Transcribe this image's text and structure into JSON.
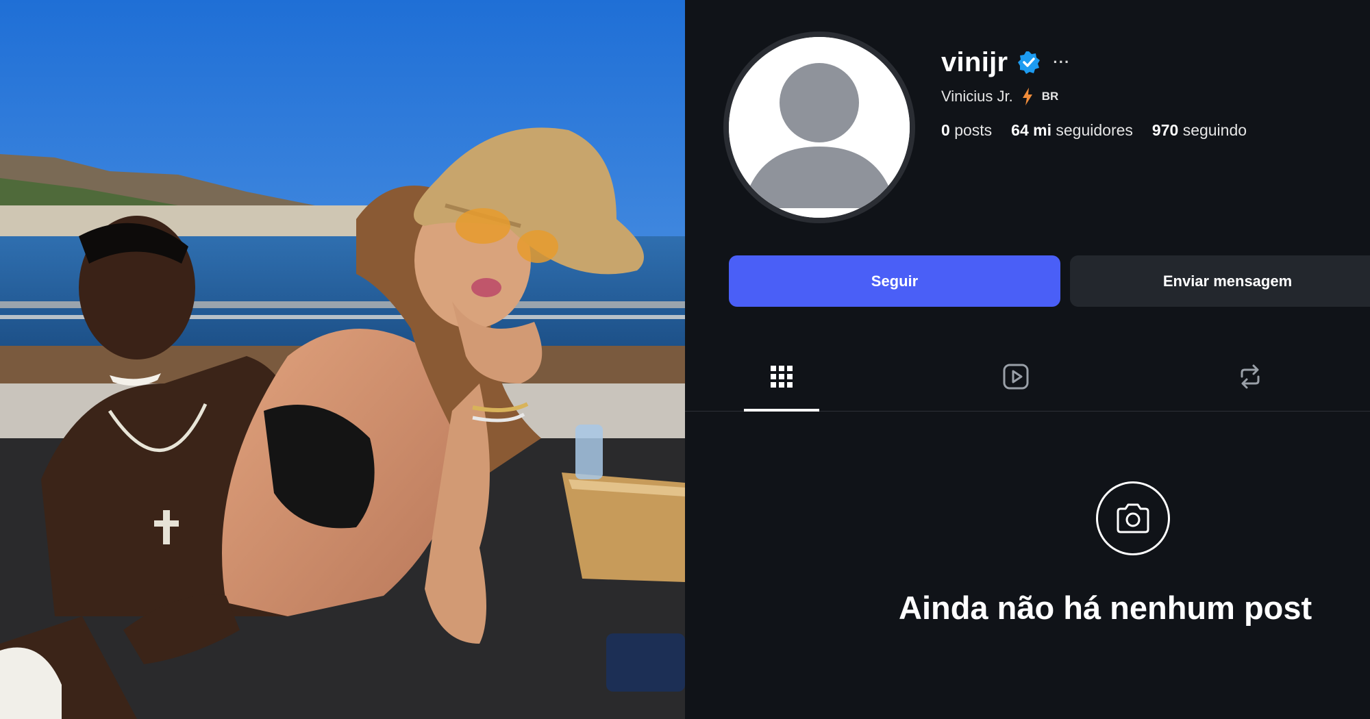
{
  "profile": {
    "username": "vinijr",
    "more_label": "···",
    "full_name": "Vinicius Jr.",
    "country_code": "BR",
    "stats": {
      "posts_value": "0",
      "posts_label": "posts",
      "followers_value": "64 mi",
      "followers_label": "seguidores",
      "following_value": "970",
      "following_label": "seguindo"
    }
  },
  "actions": {
    "follow_label": "Seguir",
    "message_label": "Enviar mensagem"
  },
  "tabs": [
    {
      "icon": "grid-icon",
      "active": true
    },
    {
      "icon": "reels-icon",
      "active": false
    },
    {
      "icon": "repost-icon",
      "active": false
    }
  ],
  "empty_state": {
    "icon": "camera-icon",
    "message": "Ainda não há nenhum post"
  },
  "colors": {
    "background": "#101318",
    "follow_button": "#4a5ff7",
    "message_button": "#23272d",
    "verified_badge": "#1d9bf0",
    "bolt": "#f08c3a"
  }
}
